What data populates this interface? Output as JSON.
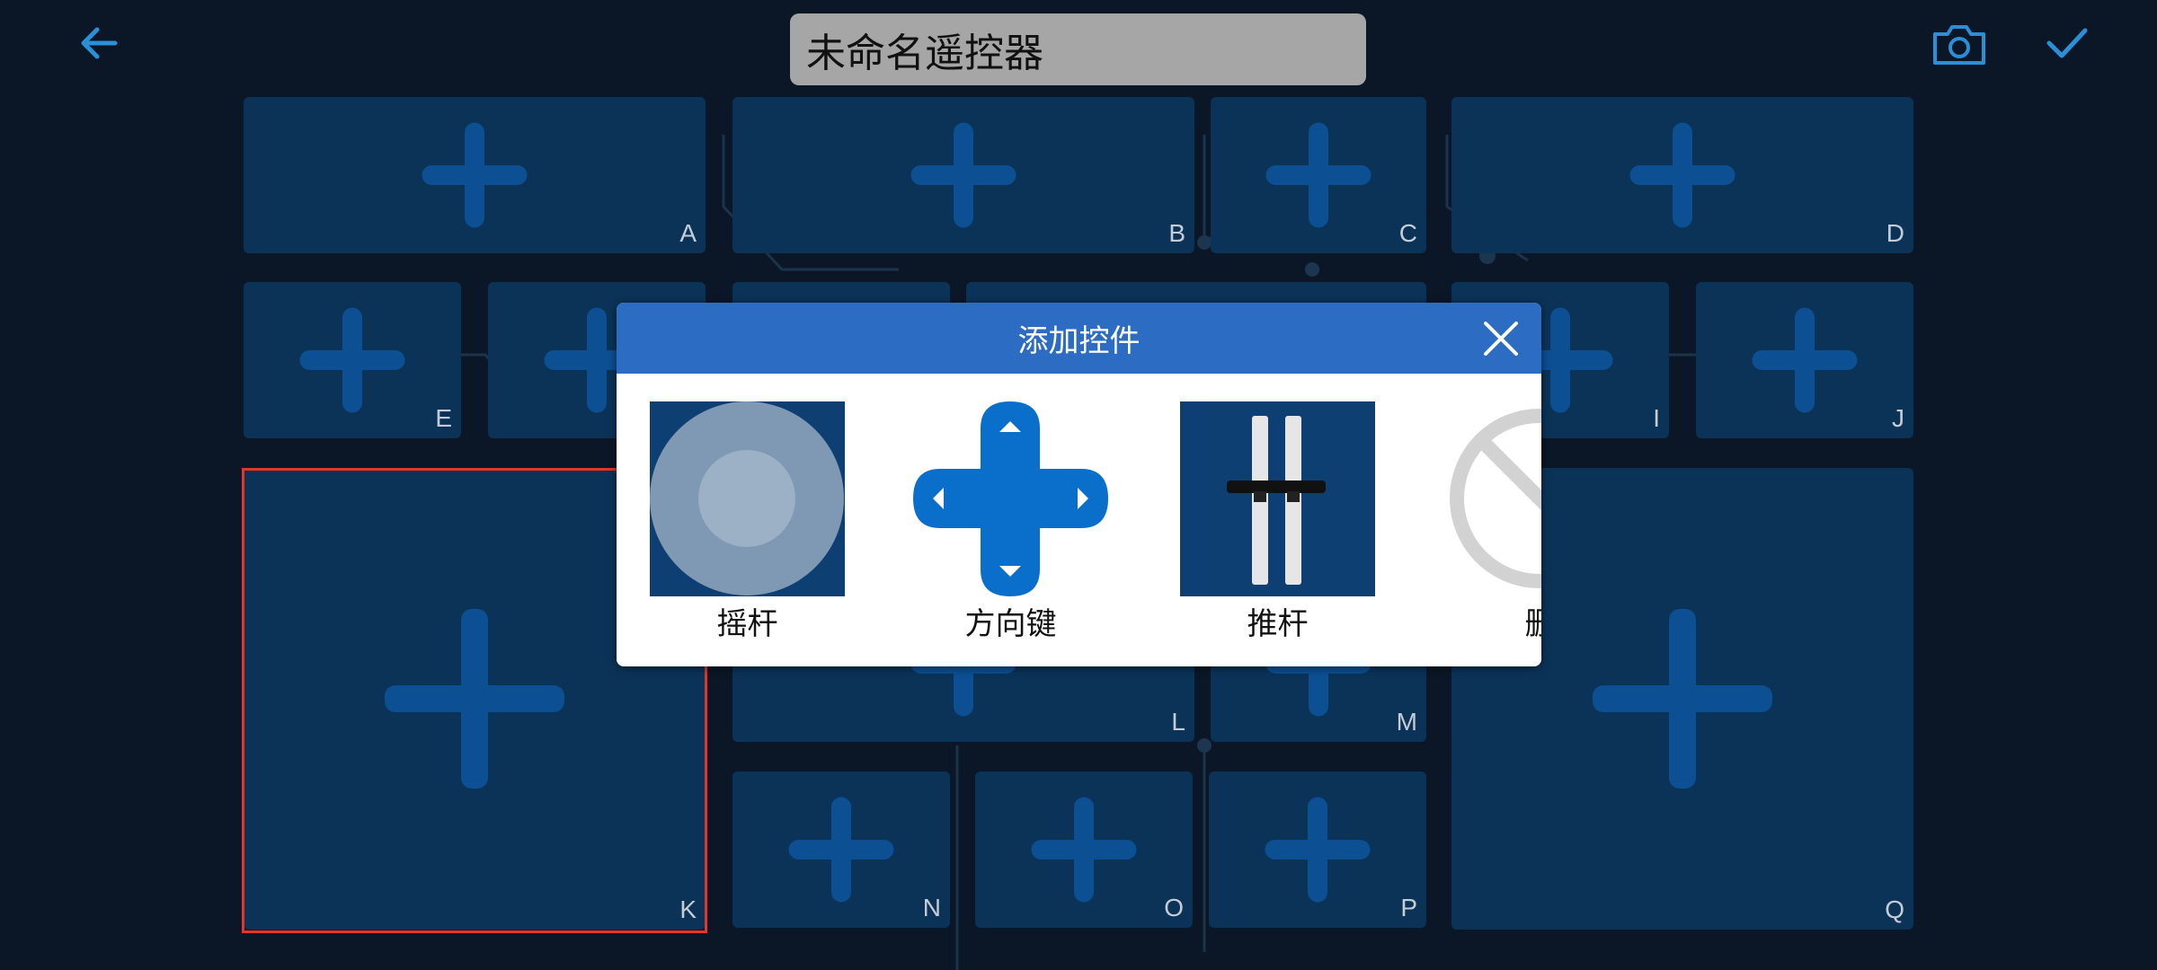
{
  "title_input": {
    "value": "未命名遥控器"
  },
  "icons": {
    "back": "arrow-left-icon",
    "camera": "camera-icon",
    "confirm": "checkmark-icon"
  },
  "grid": {
    "cells": [
      {
        "letter": "A"
      },
      {
        "letter": "B"
      },
      {
        "letter": "C"
      },
      {
        "letter": "D"
      },
      {
        "letter": "E"
      },
      {
        "letter": ""
      },
      {
        "letter": "I"
      },
      {
        "letter": "J"
      },
      {
        "letter": "K"
      },
      {
        "letter": "L"
      },
      {
        "letter": "M"
      },
      {
        "letter": "N"
      },
      {
        "letter": "O"
      },
      {
        "letter": "P"
      },
      {
        "letter": "Q"
      }
    ]
  },
  "dialog": {
    "title": "添加控件",
    "widgets": [
      {
        "label": "摇杆"
      },
      {
        "label": "方向键"
      },
      {
        "label": "推杆"
      },
      {
        "label": "删"
      }
    ]
  },
  "colors": {
    "accent": "#2c6cc2",
    "selection": "#e8332a",
    "cell": "#0b3358",
    "plus": "#0c4f93"
  }
}
